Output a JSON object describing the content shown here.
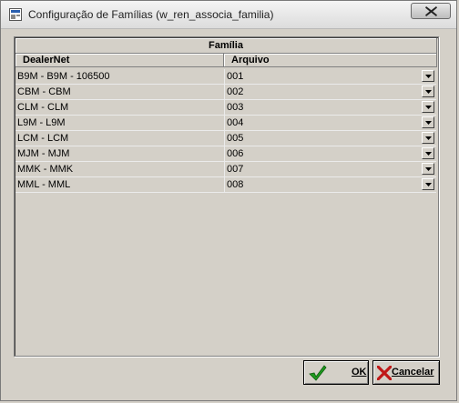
{
  "window": {
    "title": "Configuração de Famílias (w_ren_associa_familia)"
  },
  "grid": {
    "group_header": "Família",
    "columns": [
      "DealerNet",
      "Arquivo"
    ],
    "rows": [
      {
        "dealernet": "B9M - B9M - 106500",
        "arquivo": "001"
      },
      {
        "dealernet": "CBM - CBM",
        "arquivo": "002"
      },
      {
        "dealernet": "CLM - CLM",
        "arquivo": "003"
      },
      {
        "dealernet": "L9M - L9M",
        "arquivo": "004"
      },
      {
        "dealernet": "LCM - LCM",
        "arquivo": "005"
      },
      {
        "dealernet": "MJM - MJM",
        "arquivo": "006"
      },
      {
        "dealernet": "MMK - MMK",
        "arquivo": "007"
      },
      {
        "dealernet": "MML - MML",
        "arquivo": "008"
      }
    ]
  },
  "buttons": {
    "ok_label": "OK",
    "cancel_label": "Cancelar"
  },
  "colors": {
    "ok_check": "#1f9a1f",
    "cancel_x": "#c01818"
  },
  "icons": {
    "app": "window-app-icon",
    "close": "close-icon",
    "ok": "checkmark-icon",
    "cancel": "x-icon",
    "dropdown": "dropdown-arrow-icon"
  }
}
